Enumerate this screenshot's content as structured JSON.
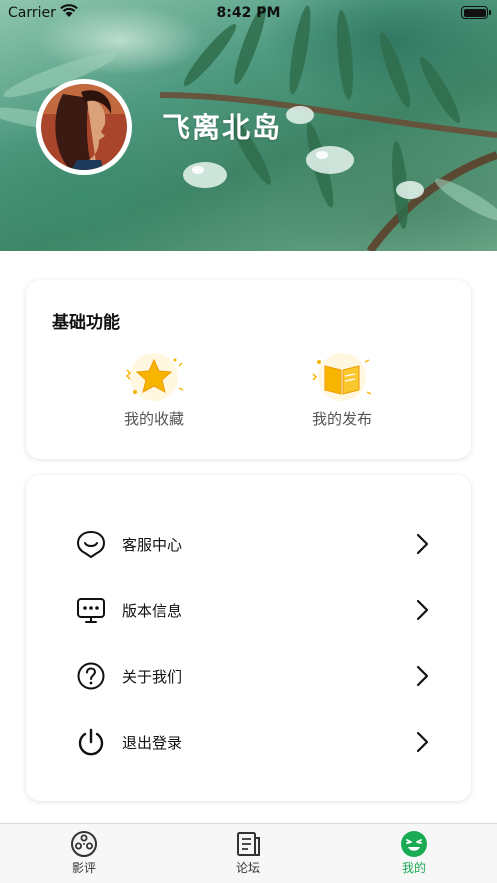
{
  "status_bar": {
    "carrier": "Carrier",
    "time": "8:42 PM"
  },
  "profile": {
    "username": "飞离北岛"
  },
  "basic_functions": {
    "title": "基础功能",
    "items": [
      {
        "label": "我的收藏",
        "icon": "star-icon"
      },
      {
        "label": "我的发布",
        "icon": "book-icon"
      }
    ]
  },
  "menu": {
    "items": [
      {
        "label": "客服中心",
        "icon": "chat-bubble-icon"
      },
      {
        "label": "版本信息",
        "icon": "monitor-dots-icon"
      },
      {
        "label": "关于我们",
        "icon": "question-circle-icon"
      },
      {
        "label": "退出登录",
        "icon": "power-icon"
      }
    ]
  },
  "tabbar": {
    "tabs": [
      {
        "label": "影评",
        "icon": "film-reel-icon",
        "active": false
      },
      {
        "label": "论坛",
        "icon": "document-icon",
        "active": false
      },
      {
        "label": "我的",
        "icon": "smiley-icon",
        "active": true
      }
    ],
    "active_color": "#1aab55"
  },
  "colors": {
    "accent": "#1aab55",
    "star": "#f7b500",
    "text": "#111111"
  }
}
